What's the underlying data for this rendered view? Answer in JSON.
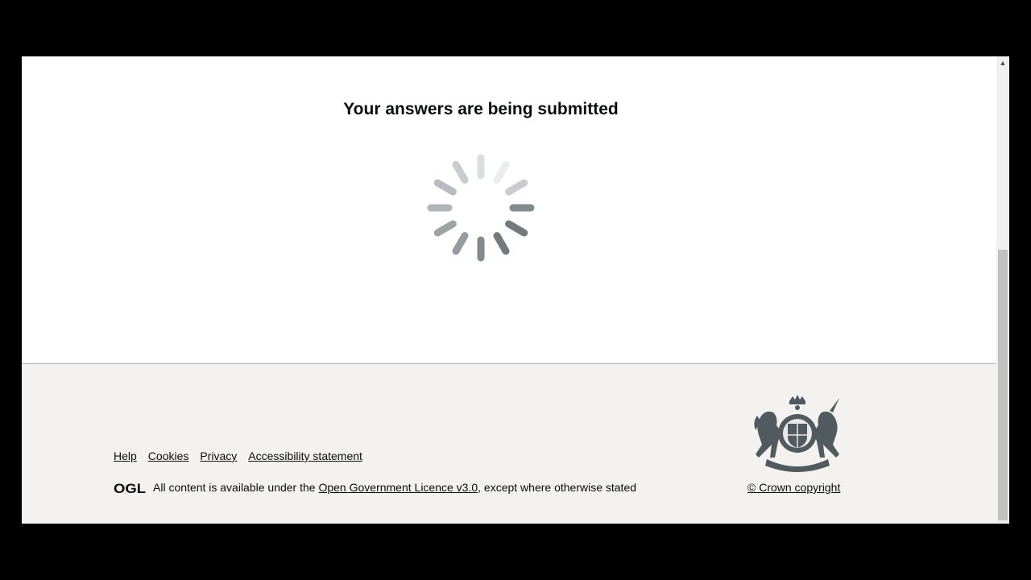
{
  "main": {
    "heading": "Your answers are being submitted",
    "spinner": {
      "segments": 12,
      "color": "#505a5f"
    }
  },
  "footer": {
    "links": [
      {
        "label": "Help"
      },
      {
        "label": "Cookies"
      },
      {
        "label": "Privacy"
      },
      {
        "label": "Accessibility statement"
      }
    ],
    "licence": {
      "logo_text": "OGL",
      "prefix": "All content is available under the ",
      "link_label": "Open Government Licence v3.0",
      "suffix": ", except where otherwise stated"
    },
    "crest_icon": "royal-coat-of-arms-icon",
    "copyright_label": "© Crown copyright"
  },
  "scrollbar": {
    "up_arrow": "▲"
  },
  "colors": {
    "text": "#0b0c0c",
    "footer_bg": "#f3f2f1",
    "footer_border": "#b1b4b6",
    "frame": "#000000"
  }
}
